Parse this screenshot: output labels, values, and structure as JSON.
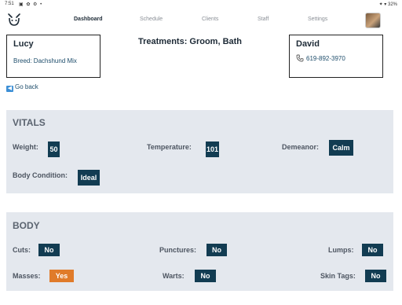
{
  "status_bar": {
    "time": "7:51",
    "icons": "▣ ✿ ⚙ •",
    "right": "✦ ▾ 32%"
  },
  "nav": {
    "items": [
      {
        "label": "Dashboard",
        "active": true
      },
      {
        "label": "Schedule",
        "active": false
      },
      {
        "label": "Clients",
        "active": false
      },
      {
        "label": "Staff",
        "active": false
      },
      {
        "label": "Settings",
        "active": false
      }
    ]
  },
  "pet": {
    "name": "Lucy",
    "breed": "Breed: Dachshund Mix"
  },
  "treatments": "Treatments: Groom, Bath",
  "owner": {
    "name": "David",
    "phone": "619-892-3970"
  },
  "go_back": "Go back",
  "vitals": {
    "title": "VITALS",
    "weight_label": "Weight:",
    "weight_value": "50",
    "temperature_label": "Temperature:",
    "temperature_value": "101",
    "demeanor_label": "Demeanor:",
    "demeanor_value": "Calm",
    "body_condition_label": "Body Condition:",
    "body_condition_value": "Ideal"
  },
  "body": {
    "title": "BODY",
    "cuts_label": "Cuts:",
    "cuts_value": "No",
    "punctures_label": "Punctures:",
    "punctures_value": "No",
    "lumps_label": "Lumps:",
    "lumps_value": "No",
    "masses_label": "Masses:",
    "masses_value": "Yes",
    "warts_label": "Warts:",
    "warts_value": "No",
    "skin_tags_label": "Skin Tags:",
    "skin_tags_value": "No"
  },
  "colors": {
    "badge_dark": "#123c52",
    "badge_alert": "#e07b2a",
    "panel_bg": "#e4e8ee"
  }
}
